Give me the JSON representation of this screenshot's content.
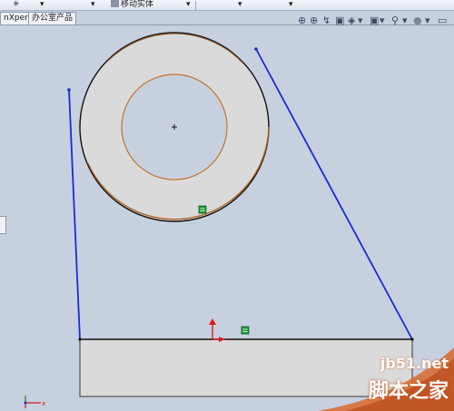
{
  "toolbar": {
    "items": [
      "✳",
      "▾",
      "▾",
      "移动实体",
      "▾",
      "▾",
      "▾"
    ]
  },
  "tabs": [
    "nXpert",
    "办公室产品"
  ],
  "view_tools": [
    "⊕",
    "⊕",
    "↯",
    "▣",
    "◈",
    "▾",
    "▣",
    "▾",
    "⚲",
    "▾",
    "●",
    "▾",
    "▭"
  ],
  "watermark": {
    "site": "jb51.net",
    "name": "脚本之家"
  },
  "colors": {
    "background": "#c7d0df",
    "part_fill": "#dadada",
    "outline": "#111111",
    "construction_line": "#1b2bd0",
    "hole_edge": "#c6722a",
    "origin_red": "#e01818",
    "badge_green": "#1f9d3b"
  }
}
